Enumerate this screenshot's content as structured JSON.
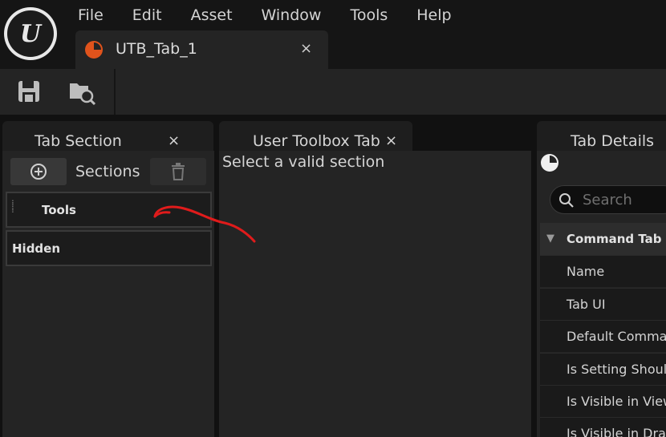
{
  "menu": {
    "items": [
      "File",
      "Edit",
      "Asset",
      "Window",
      "Tools",
      "Help"
    ]
  },
  "document_tab": {
    "title": "UTB_Tab_1",
    "close": "×"
  },
  "toolbar": {
    "save_icon": "save-icon",
    "browse_icon": "browse-asset-icon"
  },
  "tab_section": {
    "title": "Tab Section",
    "close": "×",
    "sections_label": "Sections",
    "rows": [
      "Tools",
      "Hidden"
    ]
  },
  "toolbox_tab": {
    "title": "User Toolbox Tab",
    "close": "×",
    "message": "Select a valid section"
  },
  "tab_details": {
    "title": "Tab Details",
    "search_placeholder": "Search",
    "category": "Command Tab",
    "rows": [
      "Name",
      "Tab UI",
      "Default Command",
      "Is Setting Should",
      "Is Visible in Viewp",
      "Is Visible in Draw"
    ]
  },
  "colors": {
    "accent_orange": "#e0531c",
    "annotation_red": "#e01b1b",
    "panel_bg": "#242424"
  }
}
